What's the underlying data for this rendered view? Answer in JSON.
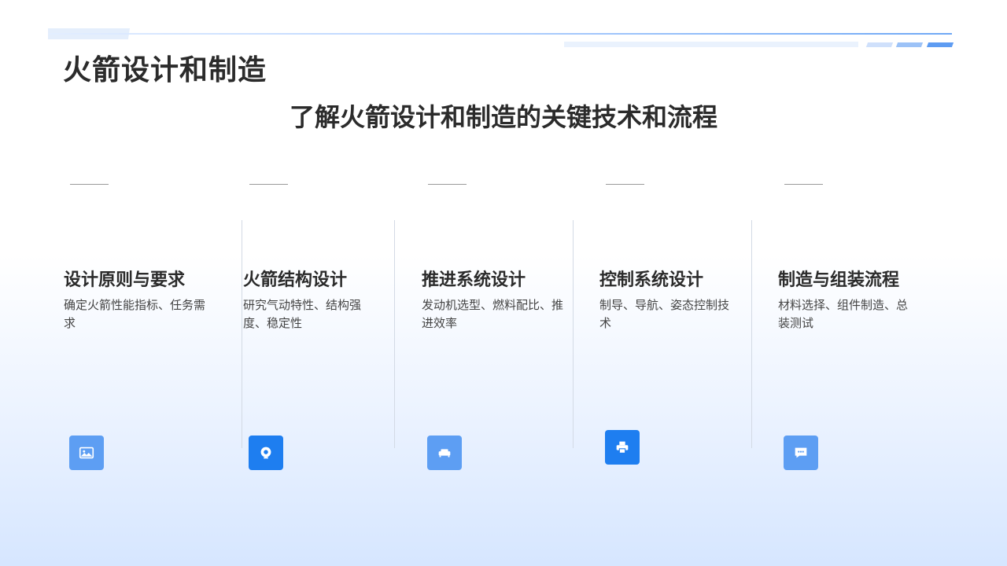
{
  "header": {
    "title": "火箭设计和制造",
    "subtitle": "了解火箭设计和制造的关键技术和流程"
  },
  "colors": {
    "accent": "#1e7ef0",
    "accent_light": "#5d9ef3",
    "text": "#2b2b2b"
  },
  "columns": [
    {
      "title": "设计原则与要求",
      "desc": "确定火箭性能指标、任务需求",
      "icon": "image-icon"
    },
    {
      "title": "火箭结构设计",
      "desc": "研究气动特性、结构强度、稳定性",
      "icon": "location-icon"
    },
    {
      "title": "推进系统设计",
      "desc": "发动机选型、燃料配比、推进效率",
      "icon": "sofa-icon"
    },
    {
      "title": "控制系统设计",
      "desc": "制导、导航、姿态控制技术",
      "icon": "printer-icon"
    },
    {
      "title": "制造与组装流程",
      "desc": "材料选择、组件制造、总装测试",
      "icon": "chat-icon"
    }
  ]
}
